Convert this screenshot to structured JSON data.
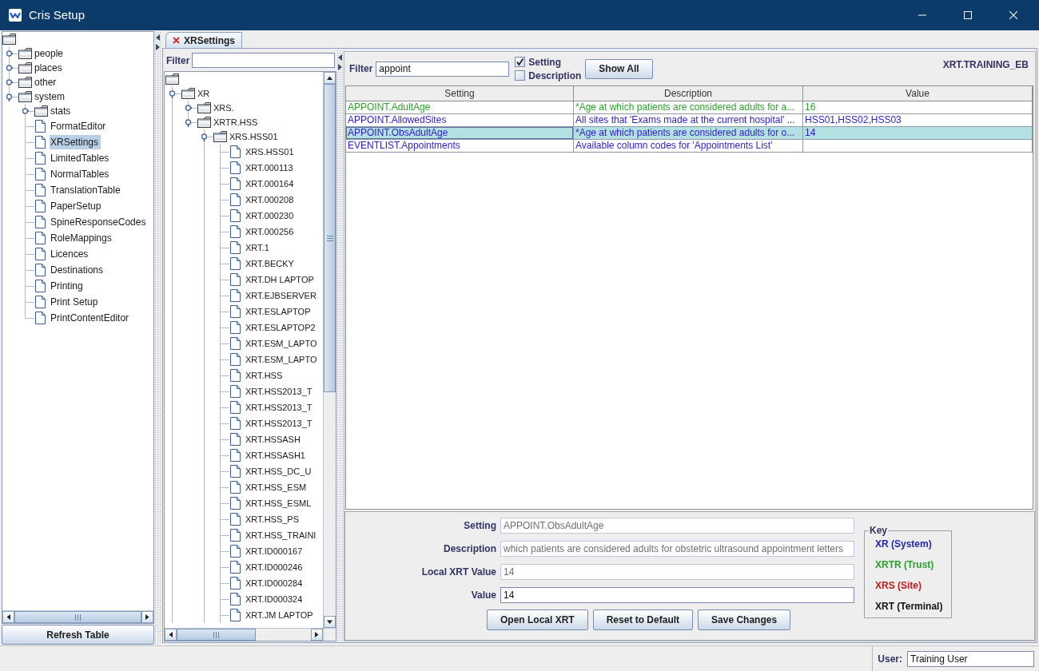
{
  "window": {
    "title": "Cris Setup"
  },
  "nav_tree": {
    "nodes": [
      {
        "kind": "folder",
        "children": [
          {
            "label": "people",
            "kind": "folder",
            "expanded": false,
            "selected": false
          },
          {
            "label": "places",
            "kind": "folder",
            "expanded": false,
            "selected": false
          },
          {
            "label": "other",
            "kind": "folder",
            "expanded": false,
            "selected": false
          },
          {
            "label": "system",
            "kind": "folder",
            "expanded": true,
            "selected": false,
            "children": [
              {
                "label": "stats",
                "kind": "folder",
                "expanded": false,
                "selected": false
              },
              {
                "label": "FormatEditor",
                "kind": "document",
                "selected": false
              },
              {
                "label": "XRSettings",
                "kind": "document",
                "selected": true
              },
              {
                "label": "LimitedTables",
                "kind": "document",
                "selected": false
              },
              {
                "label": "NormalTables",
                "kind": "document",
                "selected": false
              },
              {
                "label": "TranslationTable",
                "kind": "document",
                "selected": false
              },
              {
                "label": "PaperSetup",
                "kind": "document",
                "selected": false
              },
              {
                "label": "SpineResponseCodes",
                "kind": "document",
                "selected": false
              },
              {
                "label": "RoleMappings",
                "kind": "document",
                "selected": false
              },
              {
                "label": "Licences",
                "kind": "document",
                "selected": false
              },
              {
                "label": "Destinations",
                "kind": "document",
                "selected": false
              },
              {
                "label": "Printing",
                "kind": "document",
                "selected": false
              },
              {
                "label": "Print Setup",
                "kind": "document",
                "selected": false
              },
              {
                "label": "PrintContentEditor",
                "kind": "document",
                "selected": false
              }
            ]
          }
        ]
      }
    ]
  },
  "refresh_button": "Refresh Table",
  "tabs": [
    {
      "label": "XRSettings",
      "selected": true
    }
  ],
  "xr_tree": {
    "filter": {
      "label": "Filter"
    },
    "nodes": [
      {
        "kind": "folder",
        "children": [
          {
            "label": "XR",
            "kind": "folder",
            "expanded": true,
            "selected": false,
            "more_below": true,
            "children": [
              {
                "label": "XRS.",
                "kind": "folder",
                "expanded": false,
                "selected": false
              },
              {
                "label": "XRTR.HSS",
                "kind": "folder",
                "expanded": true,
                "selected": false,
                "children": [
                  {
                    "label": "XRS.HSS01",
                    "kind": "folder",
                    "expanded": true,
                    "selected": false,
                    "more_below": true,
                    "children": [
                      {
                        "label": "XRS.HSS01",
                        "kind": "document",
                        "selected": false
                      },
                      {
                        "label": "XRT.000113",
                        "kind": "document",
                        "selected": false
                      },
                      {
                        "label": "XRT.000164",
                        "kind": "document",
                        "selected": false
                      },
                      {
                        "label": "XRT.000208",
                        "kind": "document",
                        "selected": false
                      },
                      {
                        "label": "XRT.000230",
                        "kind": "document",
                        "selected": false
                      },
                      {
                        "label": "XRT.000256",
                        "kind": "document",
                        "selected": false
                      },
                      {
                        "label": "XRT.1",
                        "kind": "document",
                        "selected": false
                      },
                      {
                        "label": "XRT.BECKY",
                        "kind": "document",
                        "selected": false
                      },
                      {
                        "label": "XRT.DH LAPTOP",
                        "kind": "document",
                        "selected": false
                      },
                      {
                        "label": "XRT.EJBSERVER",
                        "kind": "document",
                        "selected": false
                      },
                      {
                        "label": "XRT.ESLAPTOP",
                        "kind": "document",
                        "selected": false
                      },
                      {
                        "label": "XRT.ESLAPTOP2",
                        "kind": "document",
                        "selected": false
                      },
                      {
                        "label": "XRT.ESM_LAPTO",
                        "kind": "document",
                        "selected": false
                      },
                      {
                        "label": "XRT.ESM_LAPTO",
                        "kind": "document",
                        "selected": false
                      },
                      {
                        "label": "XRT.HSS",
                        "kind": "document",
                        "selected": false
                      },
                      {
                        "label": "XRT.HSS2013_T",
                        "kind": "document",
                        "selected": false
                      },
                      {
                        "label": "XRT.HSS2013_T",
                        "kind": "document",
                        "selected": false
                      },
                      {
                        "label": "XRT.HSS2013_T",
                        "kind": "document",
                        "selected": false
                      },
                      {
                        "label": "XRT.HSSASH",
                        "kind": "document",
                        "selected": false
                      },
                      {
                        "label": "XRT.HSSASH1",
                        "kind": "document",
                        "selected": false
                      },
                      {
                        "label": "XRT.HSS_DC_U",
                        "kind": "document",
                        "selected": false
                      },
                      {
                        "label": "XRT.HSS_ESM",
                        "kind": "document",
                        "selected": false
                      },
                      {
                        "label": "XRT.HSS_ESML",
                        "kind": "document",
                        "selected": false
                      },
                      {
                        "label": "XRT.HSS_PS",
                        "kind": "document",
                        "selected": false
                      },
                      {
                        "label": "XRT.HSS_TRAINI",
                        "kind": "document",
                        "selected": false
                      },
                      {
                        "label": "XRT.ID000167",
                        "kind": "document",
                        "selected": false
                      },
                      {
                        "label": "XRT.ID000246",
                        "kind": "document",
                        "selected": false
                      },
                      {
                        "label": "XRT.ID000284",
                        "kind": "document",
                        "selected": false
                      },
                      {
                        "label": "XRT.ID000324",
                        "kind": "document",
                        "selected": false
                      },
                      {
                        "label": "XRT.JM LAPTOP",
                        "kind": "document",
                        "selected": false,
                        "more_below": true
                      }
                    ]
                  }
                ]
              }
            ]
          }
        ]
      }
    ]
  },
  "settings": {
    "filter": {
      "label": "Filter",
      "value": "appoint"
    },
    "options": [
      {
        "label": "Setting",
        "checked": true
      },
      {
        "label": "Description",
        "checked": false
      }
    ],
    "show_all_button": "Show All",
    "terminal": "XRT.TRAINING_EB"
  },
  "table": {
    "columns": [
      "Setting",
      "Description",
      "Value"
    ],
    "rows": [
      {
        "cells": [
          "APPOINT.AdultAge",
          "*Age at which patients are considered adults for a...",
          "16"
        ],
        "color": "#2ca02c",
        "selected": false
      },
      {
        "cells": [
          "APPOINT.AllowedSites",
          "All sites that 'Exams made at the current hospital' ...",
          "HSS01,HSS02,HSS03"
        ],
        "color": "#2f1cc6",
        "selected": false
      },
      {
        "cells": [
          "APPOINT.ObsAdultAge",
          "*Age at which patients are considered adults for o...",
          "14"
        ],
        "color": "#2f1cc6",
        "selected": true
      },
      {
        "cells": [
          "EVENTLIST.Appointments",
          "Available column codes for 'Appointments List'"
        ],
        "color": "#2f1cc6",
        "selected": false
      }
    ]
  },
  "details": {
    "fields": [
      {
        "label": "Setting",
        "value": "APPOINT.ObsAdultAge",
        "disabled": true
      },
      {
        "label": "Description",
        "value": "which patients are considered adults for obstetric ultrasound appointment letters",
        "disabled": true
      },
      {
        "label": "Local XRT Value",
        "value": "14",
        "disabled": true
      },
      {
        "label": "Value",
        "value": "14",
        "disabled": false
      }
    ],
    "buttons": [
      "Open Local XRT",
      "Reset to Default",
      "Save Changes"
    ]
  },
  "key": {
    "title": "Key",
    "items": [
      {
        "label": "XR (System)",
        "color": "#2626a6"
      },
      {
        "label": "XRTR (Trust)",
        "color": "#2ca02c"
      },
      {
        "label": "XRS (Site)",
        "color": "#b81c1c"
      },
      {
        "label": "XRT (Terminal)",
        "color": "#111111"
      }
    ]
  },
  "status_bar": {
    "user_label": "User:",
    "user": "Training User"
  }
}
